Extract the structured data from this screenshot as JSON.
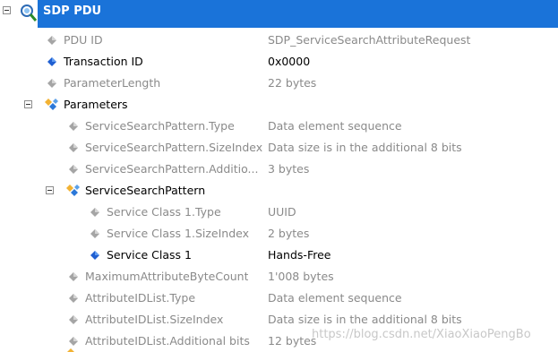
{
  "header": {
    "title": "SDP PDU"
  },
  "rows": [
    {
      "name": "PDU ID",
      "value": "SDP_ServiceSearchAttributeRequest"
    },
    {
      "name": "Transaction ID",
      "value": "0x0000"
    },
    {
      "name": "ParameterLength",
      "value": "22 bytes"
    },
    {
      "name": "Parameters"
    },
    {
      "name": "ServiceSearchPattern.Type",
      "value": "Data element sequence"
    },
    {
      "name": "ServiceSearchPattern.SizeIndex",
      "value": "Data size is in the additional 8 bits"
    },
    {
      "name": "ServiceSearchPattern.Additio...",
      "value": "3 bytes"
    },
    {
      "name": "ServiceSearchPattern"
    },
    {
      "name": "Service Class 1.Type",
      "value": "UUID"
    },
    {
      "name": "Service Class 1.SizeIndex",
      "value": "2 bytes"
    },
    {
      "name": "Service Class 1",
      "value": "Hands-Free"
    },
    {
      "name": "MaximumAttributeByteCount",
      "value": "1'008 bytes"
    },
    {
      "name": "AttributeIDList.Type",
      "value": "Data element sequence"
    },
    {
      "name": "AttributeIDList.SizeIndex",
      "value": "Data size is in the additional 8 bits"
    },
    {
      "name": "AttributeIDList.Additional bits",
      "value": "12 bytes"
    }
  ],
  "watermark": "https://blog.csdn.net/XiaoXiaoPengBo",
  "colors": {
    "header": "#1a73d9",
    "gray_text": "#8a8a8a",
    "icon_blue": "#1f5fd1",
    "icon_gray": "#9a9a9a"
  }
}
